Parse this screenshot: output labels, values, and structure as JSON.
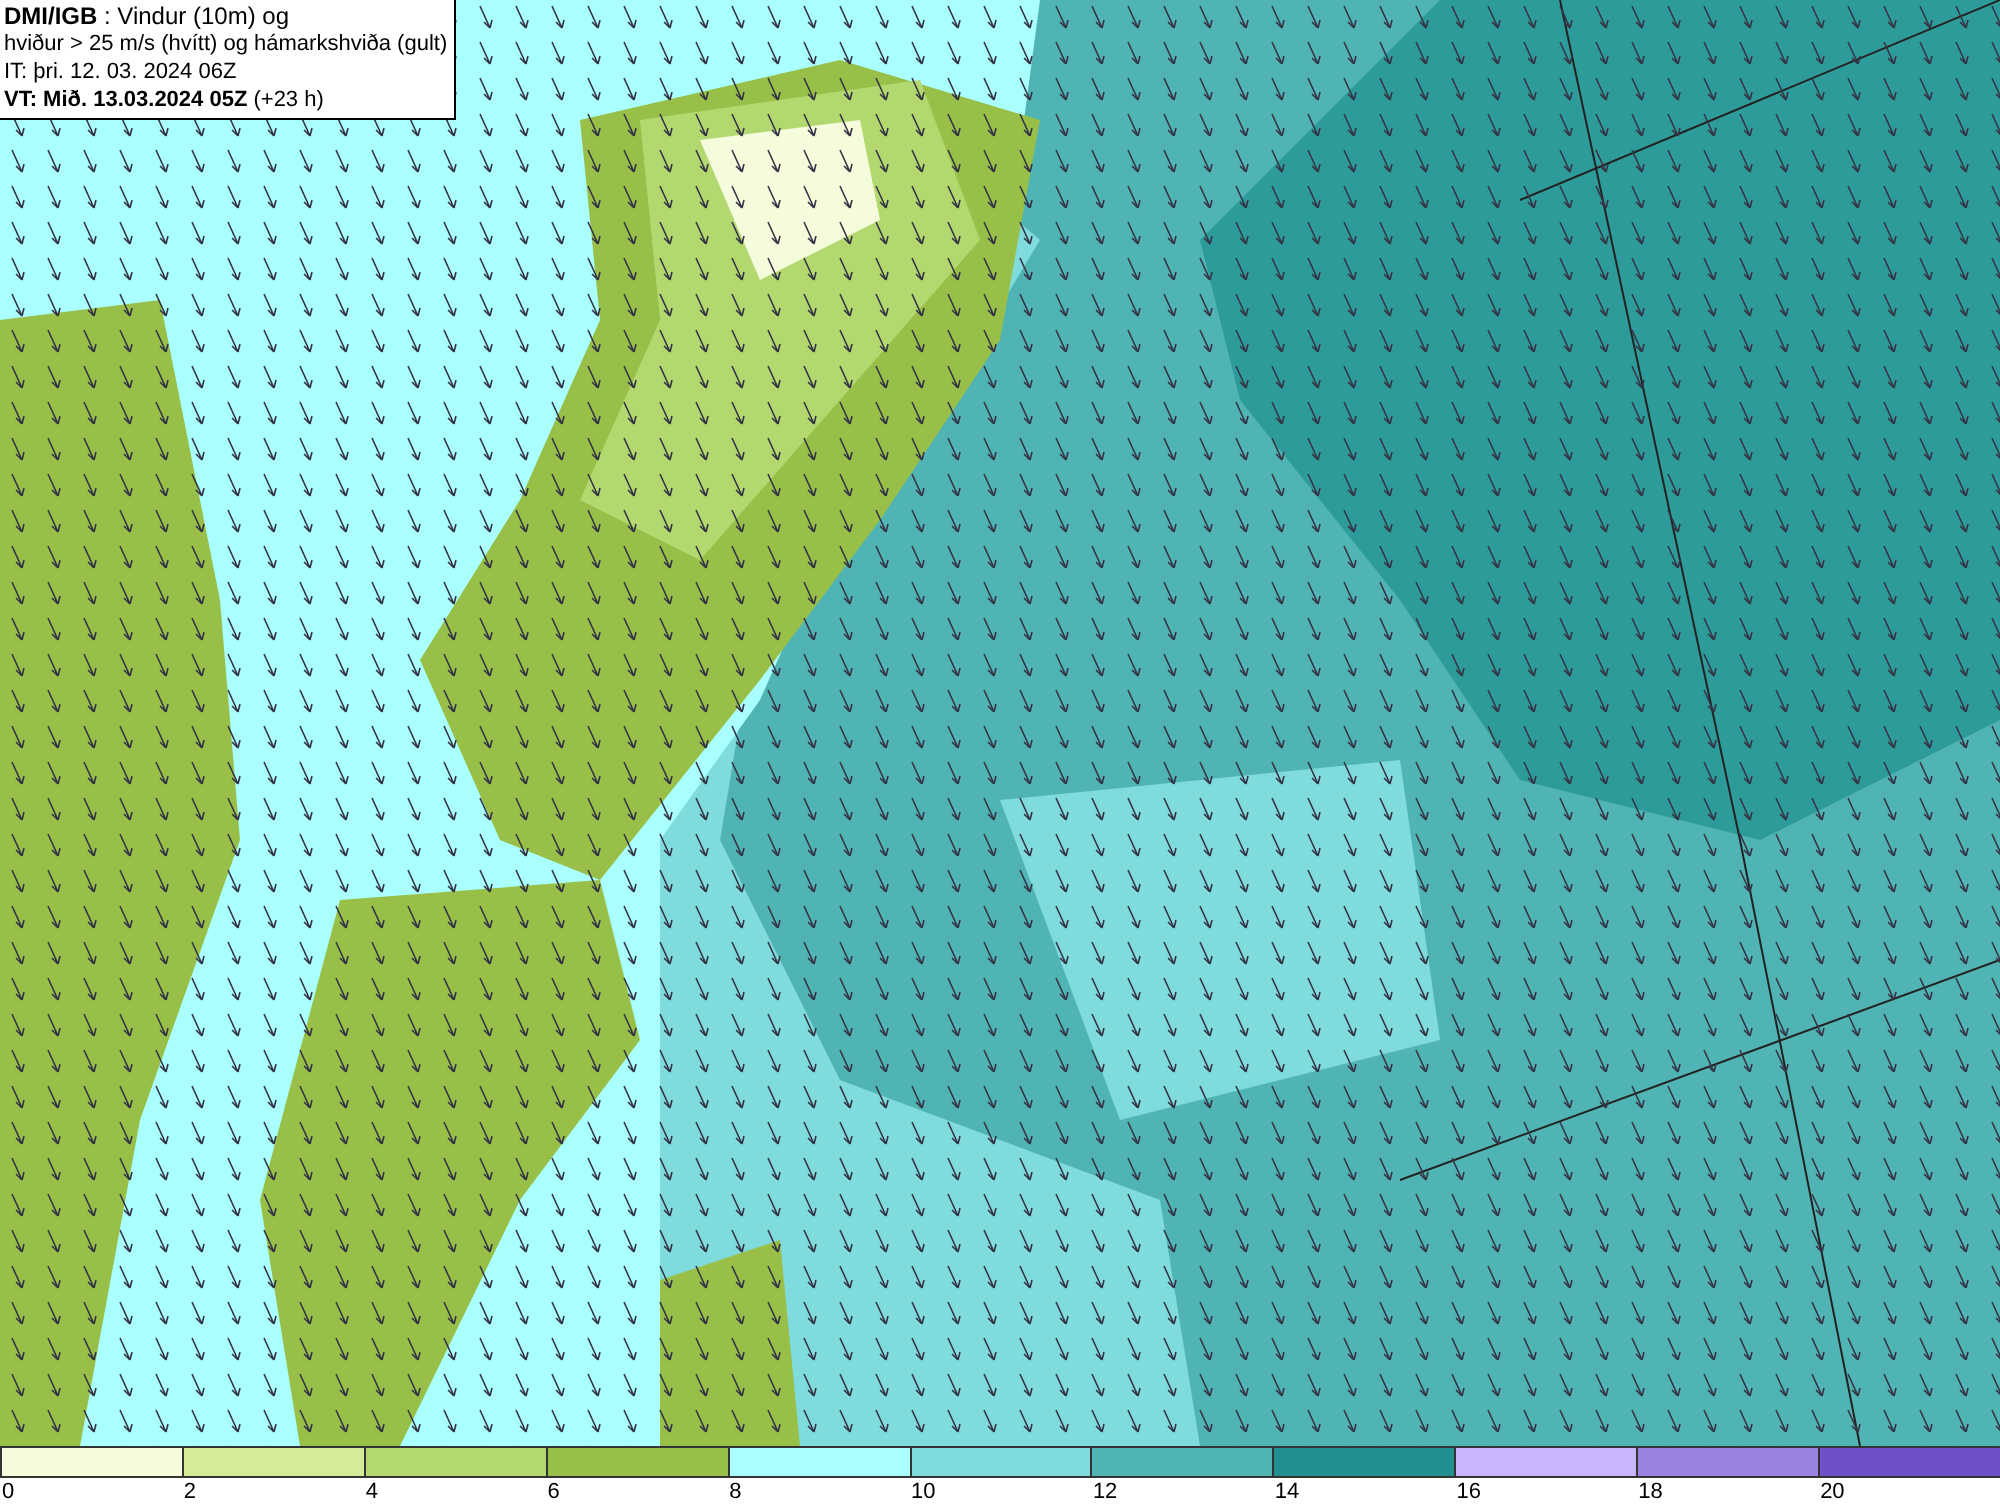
{
  "title_box": {
    "lines": [
      "**DMI/IGB** : Vindur (10m) og",
      "hviður > 25 m/s (hvítt) og hámarkshviða (gult)",
      "IT: þri. 12. 03. 2024 06Z",
      "**VT: Mið. 13.03.2024 05Z** (+23 h)"
    ]
  },
  "legend": {
    "bins": [
      {
        "color": "#f5fcdc",
        "label": "0"
      },
      {
        "color": "#d4ec98",
        "label": "2"
      },
      {
        "color": "#b4d870",
        "label": "4"
      },
      {
        "color": "#98c048",
        "label": "6"
      },
      {
        "color": "#aaffff",
        "label": "8"
      },
      {
        "color": "#80dcdc",
        "label": "10"
      },
      {
        "color": "#50b4b4",
        "label": "12"
      },
      {
        "color": "#209090",
        "label": "14"
      },
      {
        "color": "#c8b4ff",
        "label": "16"
      },
      {
        "color": "#9a82e0",
        "label": "18"
      },
      {
        "color": "#7050c8",
        "label": "20"
      }
    ]
  }
}
